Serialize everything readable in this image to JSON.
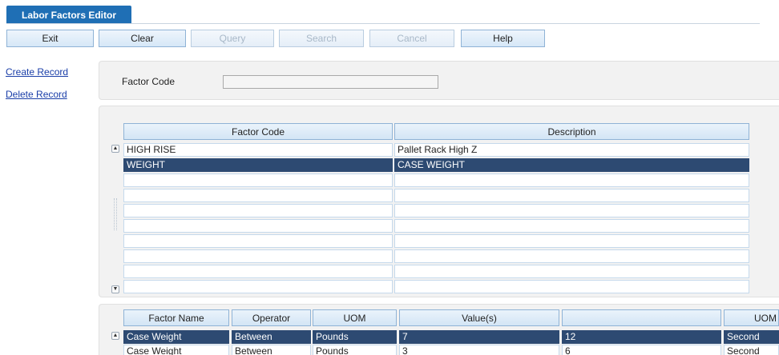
{
  "window": {
    "title": "Labor Factors Editor"
  },
  "toolbar": {
    "exit": "Exit",
    "clear": "Clear",
    "query": "Query",
    "search": "Search",
    "cancel": "Cancel",
    "help": "Help"
  },
  "sidebar": {
    "create_record": "Create Record",
    "delete_record": "Delete Record"
  },
  "filter": {
    "factor_code_label": "Factor Code",
    "factor_code_value": ""
  },
  "factors_table": {
    "headers": {
      "factor_code": "Factor Code",
      "description": "Description"
    },
    "rows": [
      {
        "factor_code": "HIGH RISE",
        "description": "Pallet Rack High Z"
      },
      {
        "factor_code": "WEIGHT",
        "description": "CASE WEIGHT"
      }
    ],
    "selected_row": 1
  },
  "details_table": {
    "headers": {
      "factor_name": "Factor Name",
      "operator": "Operator",
      "uom": "UOM",
      "values": "Value(s)",
      "blank": "",
      "uom2": "UOM"
    },
    "rows": [
      {
        "factor_name": "Case Weight",
        "operator": "Between",
        "uom": "Pounds",
        "value1": "7",
        "value2": "12",
        "uom2": "Second"
      },
      {
        "factor_name": "Case Weight",
        "operator": "Between",
        "uom": "Pounds",
        "value1": "3",
        "value2": "6",
        "uom2": "Second"
      }
    ],
    "selected_row": 0
  },
  "colors": {
    "accent": "#1f6fb5",
    "selected_row": "#2d4a72",
    "link": "#1a3ea8"
  },
  "icons": {
    "scroll_up": "triangle-up-icon",
    "scroll_down": "triangle-down-icon"
  }
}
